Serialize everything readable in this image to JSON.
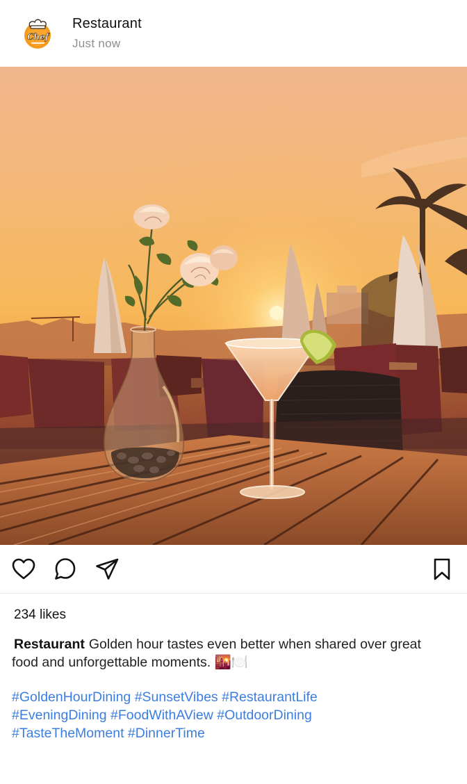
{
  "post": {
    "account_name": "Restaurant",
    "timestamp": "Just now",
    "avatar_logo_text": "Chef",
    "likes": "234 likes",
    "caption": {
      "username": "Restaurant",
      "text": "Golden hour tastes even better when shared over great food and unforgettable moments. 🌇🍽️"
    },
    "hashtag_lines": [
      [
        "#GoldenHourDining",
        "#SunsetVibes",
        "#RestaurantLife"
      ],
      [
        "#EveningDining",
        "#FoodWithAView",
        "#OutdoorDining"
      ],
      [
        "#TasteTheMoment",
        "#DinnerTime"
      ]
    ]
  },
  "actions": {
    "icons": [
      "heart-icon",
      "comment-icon",
      "send-icon",
      "bookmark-icon"
    ]
  },
  "colors": {
    "hashtag": "#3b7de0",
    "timestamp": "#8e8e8e",
    "logo_orange": "#f59a1b",
    "sky_top": "#f2b98a",
    "sky_mid": "#f6b35a",
    "sun": "#fff1b8"
  }
}
